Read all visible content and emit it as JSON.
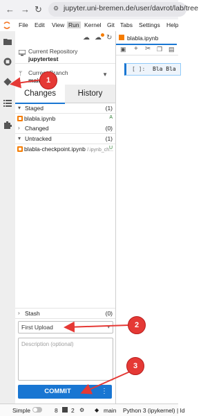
{
  "browser": {
    "url": "jupyter.uni-bremen.de/user/davrot/lab/tree"
  },
  "menu": {
    "items": [
      "File",
      "Edit",
      "View",
      "Run",
      "Kernel",
      "Git",
      "Tabs",
      "Settings",
      "Help"
    ],
    "active": "Run"
  },
  "git_panel": {
    "repo_caption": "Current Repository",
    "repo_name": "jupytertest",
    "branch_caption": "Current Branch",
    "branch_name": "main",
    "tabs": {
      "changes": "Changes",
      "history": "History"
    },
    "staged": {
      "title": "Staged",
      "count": "(1)",
      "files": [
        {
          "name": "blabla.ipynb",
          "status": "A"
        }
      ]
    },
    "changed": {
      "title": "Changed",
      "count": "(0)"
    },
    "untracked": {
      "title": "Untracked",
      "count": "(1)",
      "files": [
        {
          "name": "blabla-checkpoint.ipynb",
          "path": "/.ipynb_ch...",
          "status": "U"
        }
      ]
    },
    "stash": {
      "title": "Stash",
      "count": "(0)"
    },
    "summary_value": "First Upload",
    "description_placeholder": "Description (optional)",
    "commit_label": "COMMIT",
    "commit_more": "⋮"
  },
  "notebook": {
    "tab_title": "blabla.ipynb",
    "cell_prompt": "[ ]:",
    "cell_text": "Bla Bla"
  },
  "status_bar": {
    "mode": "Simple",
    "num1": "8",
    "num2": "2",
    "branch": "main",
    "kernel": "Python 3 (ipykernel) | Id"
  },
  "annotations": [
    "1",
    "2",
    "3"
  ],
  "colors": {
    "accent": "#1976d2",
    "annotation": "#e53935"
  }
}
